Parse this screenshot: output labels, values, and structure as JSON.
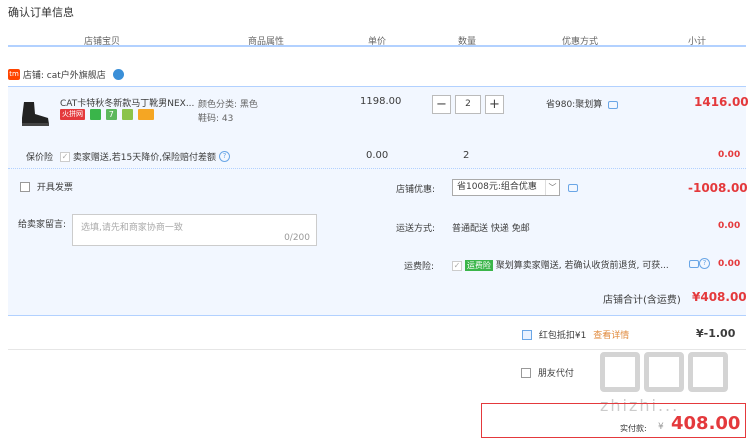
{
  "page_title": "确认订单信息",
  "columns": [
    "店铺宝贝",
    "商品属性",
    "单价",
    "数量",
    "优惠方式",
    "小计"
  ],
  "shop": {
    "icon_text": "tm",
    "label": "店铺:  cat户外旗舰店"
  },
  "item": {
    "name": "CAT卡特秋冬新款马丁靴男NEX...",
    "badge_label": "火拼网",
    "attr_color": "颜色分类:  黑色",
    "attr_size": "鞋码:  43",
    "unit_price": "1198.00",
    "quantity": "2",
    "discount": "省980:聚划算",
    "subtotal": "1416.00"
  },
  "insurance": {
    "label": "保价险",
    "text": "卖家赠送,若15天降价,保险赔付差额",
    "price": "0.00",
    "qty": "2",
    "subtotal": "0.00"
  },
  "invoice_label": "开具发票",
  "message": {
    "label": "给卖家留言:",
    "placeholder": "选填,请先和商家协商一致",
    "counter": "0/200"
  },
  "shop_discount": {
    "label": "店铺优惠:",
    "selected": "省1008元:组合优惠",
    "amount": "-1008.00"
  },
  "shipping": {
    "label": "运送方式:",
    "value": "普通配送 快递 免邮",
    "amount": "0.00"
  },
  "freight_insurance": {
    "label": "运费险:",
    "tag": "运费险",
    "text": "聚划算卖家赠送, 若确认收货前退货, 可获...",
    "amount": "0.00"
  },
  "shop_total": {
    "label": "店铺合计(含运费)",
    "amount": "¥408.00"
  },
  "red_packet": {
    "label": "红包抵扣¥1",
    "link": "查看详情",
    "amount": "¥-1.00"
  },
  "friend_pay": {
    "label": "朋友代付"
  },
  "pay": {
    "label": "实付款:",
    "currency": "¥",
    "amount": "408.00"
  },
  "watermark": "zhizhi..."
}
